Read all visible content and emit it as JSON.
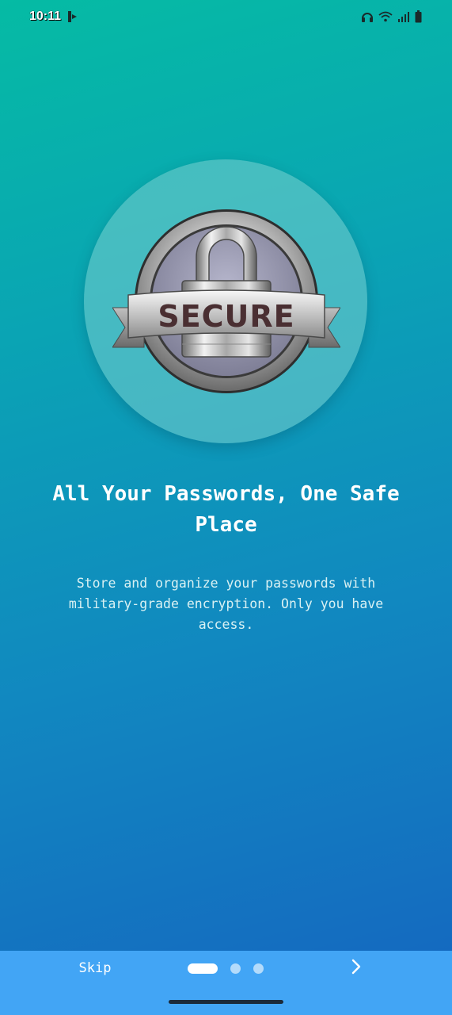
{
  "status_bar": {
    "time": "10:11",
    "left_icon": "notification-app-icon",
    "right_icons": [
      "headphones-icon",
      "wifi-icon",
      "signal-icon",
      "battery-icon"
    ]
  },
  "onboarding": {
    "illustration": "secure-padlock-badge",
    "badge_text": "SECURE",
    "title": "All Your Passwords, One Safe Place",
    "description": "Store and organize your passwords with military-grade encryption. Only you have access.",
    "current_page": 1,
    "total_pages": 3
  },
  "bottom_bar": {
    "skip_label": "Skip",
    "next_icon": "chevron-right-icon"
  },
  "colors": {
    "gradient_top": "#05bba4",
    "gradient_bottom": "#1565c0",
    "bottom_bar": "#42a5f5",
    "title_text": "#ffffff"
  }
}
